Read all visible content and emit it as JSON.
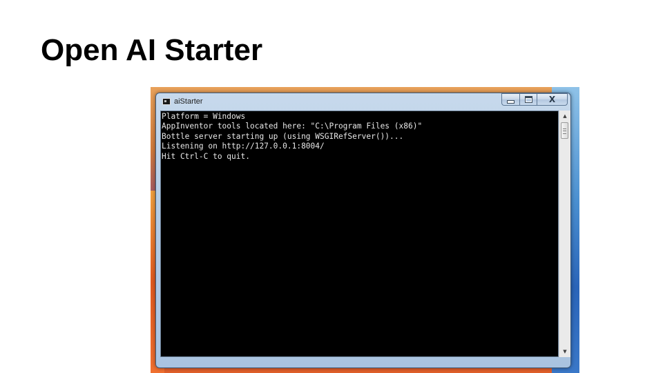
{
  "slide": {
    "title": "Open AI Starter"
  },
  "window": {
    "title": "aiStarter",
    "app_icon": "console-icon",
    "buttons": {
      "minimize_icon": "minimize-icon",
      "maximize_icon": "maximize-icon",
      "close_icon": "close-icon",
      "close_glyph": "X"
    }
  },
  "console": {
    "background": "#000000",
    "foreground": "#e8e8e8",
    "lines": [
      "Platform = Windows",
      "AppInventor tools located here: \"C:\\Program Files (x86)\"",
      "Bottle server starting up (using WSGIRefServer())...",
      "Listening on http://127.0.0.1:8004/",
      "Hit Ctrl-C to quit."
    ]
  },
  "scrollbar": {
    "up_icon": "scroll-up-arrow-icon",
    "down_icon": "scroll-down-arrow-icon",
    "up_glyph": "▲",
    "down_glyph": "▼"
  }
}
